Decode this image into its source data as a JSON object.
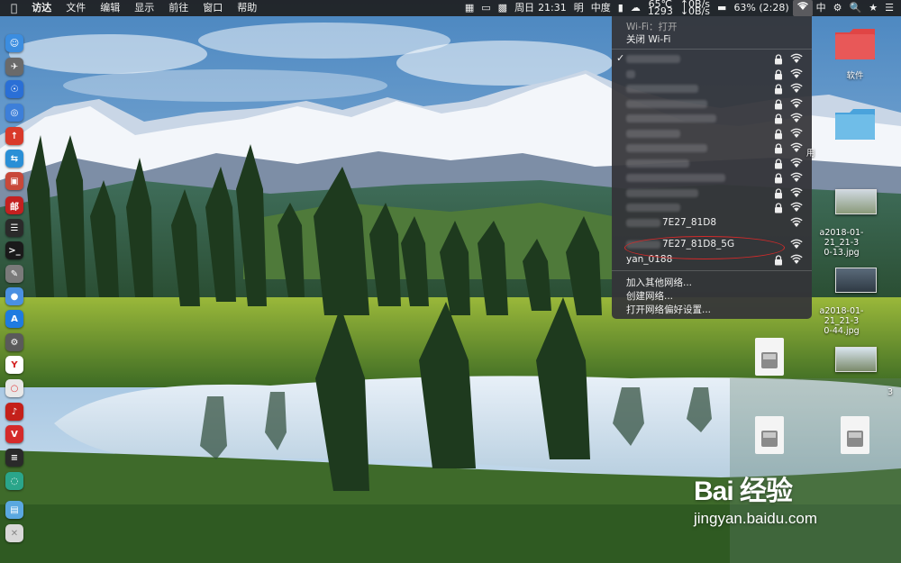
{
  "menubar": {
    "apple_icon": "apple-icon",
    "menus": [
      "访达",
      "文件",
      "编辑",
      "显示",
      "前往",
      "窗口",
      "帮助"
    ],
    "right": {
      "temp": "65℃",
      "fan": "1293",
      "net_up": "↑0B/s",
      "net_down": "↓0B/s",
      "battery": "63% (2:28)",
      "day": "周日",
      "time": "21:31",
      "weekday_short": "明",
      "ime1": "中度",
      "ime2": "中"
    }
  },
  "wifi_menu": {
    "status": "Wi-Fi：打开",
    "toggle": "关闭 Wi-Fi",
    "networks": [
      {
        "name": "",
        "connected": true,
        "secured": true
      },
      {
        "name": "",
        "connected": false,
        "secured": true
      },
      {
        "name": "",
        "connected": false,
        "secured": true
      },
      {
        "name": "",
        "connected": false,
        "secured": true
      },
      {
        "name": "",
        "connected": false,
        "secured": true
      },
      {
        "name": "",
        "connected": false,
        "secured": true
      },
      {
        "name": "",
        "connected": false,
        "secured": true
      },
      {
        "name": "",
        "connected": false,
        "secured": true
      },
      {
        "name": "",
        "connected": false,
        "secured": true
      },
      {
        "name": "",
        "connected": false,
        "secured": true
      },
      {
        "name": "",
        "connected": false,
        "secured": true
      },
      {
        "name": "7E27_81D8",
        "connected": false,
        "secured": false
      },
      {
        "name": "7E27_81D8_5G",
        "connected": false,
        "secured": false
      },
      {
        "name": "yan_0188",
        "connected": false,
        "secured": true
      }
    ],
    "actions": [
      "加入其他网络...",
      "创建网络...",
      "打开网络偏好设置..."
    ]
  },
  "desktop": {
    "folder1_label": "软件",
    "folder2_label": "",
    "partial_label": "用",
    "thumb1_label_line1": "a2018-01-21_21-3",
    "thumb1_label_line2": "0-13.jpg",
    "thumb2_label_line1": "a2018-01-21_21-3",
    "thumb2_label_line2": "0-44.jpg",
    "partial_label2": "3"
  },
  "dock": {
    "icons": [
      "finder-icon",
      "launchpad-icon",
      "safari-icon",
      "preview-icon",
      "toolbox-icon",
      "teamviewer-icon",
      "photo-icon",
      "youdao-icon",
      "activity-monitor-icon",
      "terminal-icon",
      "script-editor-icon",
      "siri-icon",
      "app-store-icon",
      "system-preferences-icon",
      "yandex-icon",
      "chrome-icon",
      "netease-music-icon",
      "vivaldi-icon",
      "console-icon",
      "cleanup-icon",
      "downloads-folder-icon",
      "trash-icon"
    ]
  },
  "watermark": {
    "logo": "Bai 经验",
    "url": "jingyan.baidu.com"
  }
}
